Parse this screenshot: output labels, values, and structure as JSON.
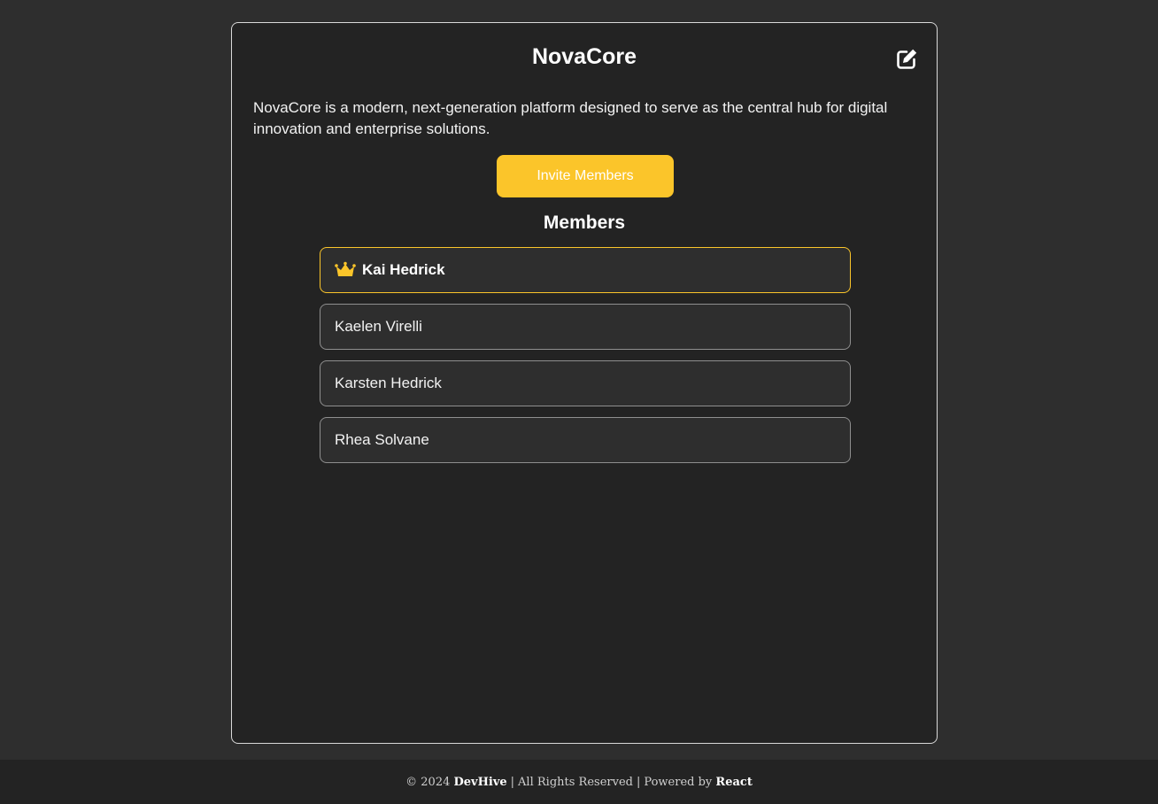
{
  "project": {
    "title": "NovaCore",
    "description": "NovaCore is a modern, next-generation platform designed to serve as the central hub for digital innovation and enterprise solutions.",
    "edit_icon": "edit-icon"
  },
  "invite": {
    "label": "Invite Members"
  },
  "members": {
    "heading": "Members",
    "items": [
      {
        "name": "Kai Hedrick",
        "role_icon": "crown-icon"
      },
      {
        "name": "Kaelen Virelli"
      },
      {
        "name": "Karsten Hedrick"
      },
      {
        "name": "Rhea Solvane"
      }
    ]
  },
  "footer": {
    "copyright": "© 2024",
    "brand": "DevHive",
    "rights": "All Rights Reserved",
    "powered_by": "Powered by",
    "tech": "React",
    "separator": "|"
  },
  "colors": {
    "accent": "#fbc52a",
    "background": "#2e2e2e",
    "card": "#232323"
  }
}
